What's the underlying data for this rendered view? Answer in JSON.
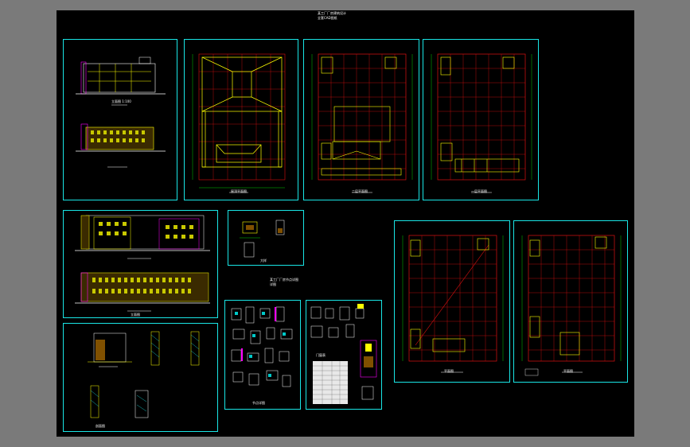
{
  "viewport": {
    "background": "#7a7a7a",
    "canvas_bg": "#000000"
  },
  "colors": {
    "frame": "#19e6e6",
    "grid": "#e01010",
    "wall": "#ffff00",
    "dim": "#00ff00",
    "accent": "#ff00ff",
    "text": "#ffffff"
  },
  "drawing_title": {
    "line1": "某工厂厂房建筑设计",
    "line2": "全套CAD图纸"
  },
  "detail_title": {
    "line1": "某工厂厂房节点详图",
    "line2": "详图"
  },
  "sheets": [
    {
      "id": "elevations-a",
      "caption": "立面图 1:100"
    },
    {
      "id": "plan-roof",
      "caption": "屋顶平面图"
    },
    {
      "id": "plan-2",
      "caption": "二层平面图"
    },
    {
      "id": "plan-1",
      "caption": "一层平面图"
    },
    {
      "id": "elevations-b",
      "caption": "立面图"
    },
    {
      "id": "detail-small",
      "caption": "大样"
    },
    {
      "id": "plan-3",
      "caption": "平面图"
    },
    {
      "id": "plan-4",
      "caption": "平面图"
    },
    {
      "id": "sections",
      "caption": "剖面图"
    },
    {
      "id": "details-a",
      "caption": "节点详图"
    },
    {
      "id": "details-b",
      "caption": "门窗表"
    }
  ]
}
